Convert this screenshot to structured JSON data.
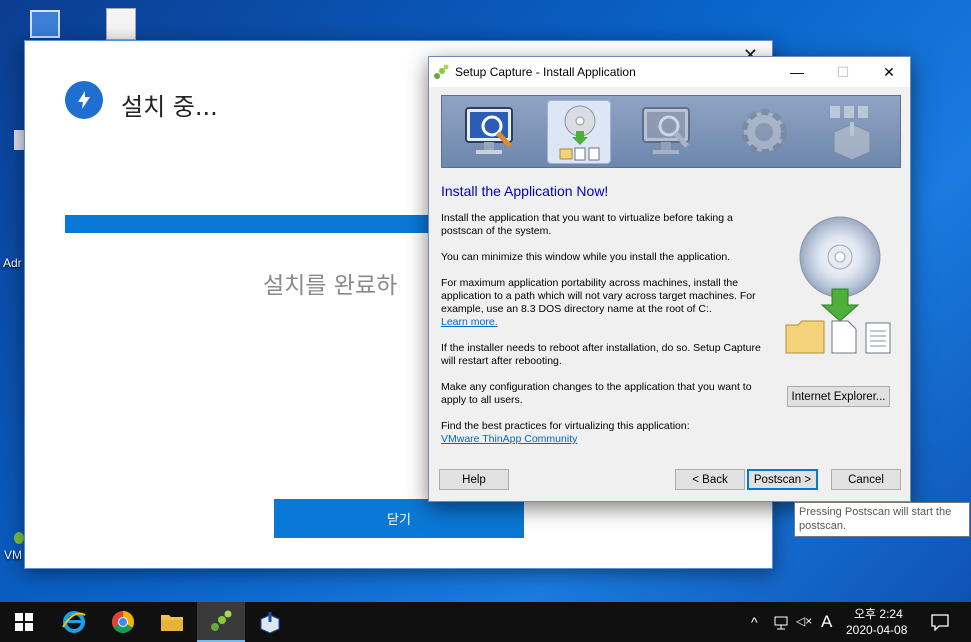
{
  "desktop": {
    "labels": [
      "Adr",
      "VM"
    ]
  },
  "installer": {
    "title": "설치 중...",
    "progress_text": "설치를 완료하",
    "close_button": "닫기",
    "close_glyph": "✕",
    "progress_fraction": 1.0
  },
  "dialog": {
    "title": "Setup Capture - Install Application",
    "controls": {
      "minimize": "—",
      "maximize": "☐",
      "close": "✕"
    },
    "heading": "Install the Application Now!",
    "paragraphs": {
      "p1": "Install the application that you want to virtualize before taking a postscan of the system.",
      "p2": "You can minimize this window while you install the application.",
      "p3": "For maximum application portability across machines, install the application to a path which will not vary across target machines. For example, use an 8.3 DOS directory name at the root of C:.",
      "p3_link": "Learn more.",
      "p4": "If the installer needs to reboot after installation, do so. Setup Capture will restart after rebooting.",
      "p5": "Make any configuration changes to the application that you want to apply to all users.",
      "p6": "Find the best practices for virtualizing this application:",
      "p6_link": "VMware ThinApp Community"
    },
    "buttons": {
      "ie": "Internet Explorer...",
      "help": "Help",
      "back": "< Back",
      "postscan": "Postscan >",
      "cancel": "Cancel"
    }
  },
  "tooltip": "Pressing Postscan will start the postscan.",
  "taskbar": {
    "time": "오후 2:24",
    "date": "2020-04-08",
    "ime": "A",
    "chevron": "^",
    "volume": "◁×"
  }
}
